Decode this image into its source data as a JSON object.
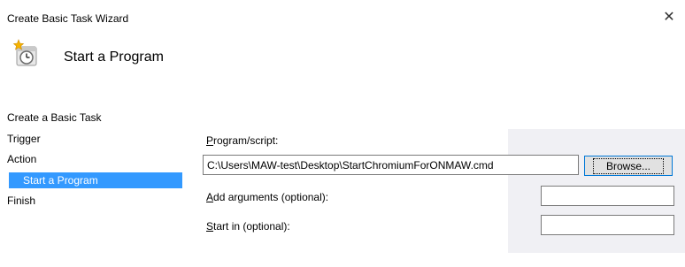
{
  "window": {
    "title": "Create Basic Task Wizard",
    "close_glyph": "✕"
  },
  "header": {
    "icon": "scheduled-task-clock-icon",
    "title": "Start a Program"
  },
  "nav": {
    "items": [
      {
        "label": "Create a Basic Task",
        "selected": false
      },
      {
        "label": "Trigger",
        "selected": false
      },
      {
        "label": "Action",
        "selected": false
      },
      {
        "label": "Start a Program",
        "selected": true
      },
      {
        "label": "Finish",
        "selected": false
      }
    ]
  },
  "form": {
    "program_label_mnemonic": "P",
    "program_label_rest": "rogram/script:",
    "program_value": "C:\\Users\\MAW-test\\Desktop\\StartChromiumForONMAW.cmd",
    "browse_label": "Browse...",
    "args_label_mnemonic": "A",
    "args_label_rest": "dd arguments (optional):",
    "args_value": "",
    "startin_label_mnemonic": "S",
    "startin_label_rest": "tart in (optional):",
    "startin_value": ""
  },
  "colors": {
    "selection": "#3399ff",
    "button_border": "#0078d7"
  }
}
